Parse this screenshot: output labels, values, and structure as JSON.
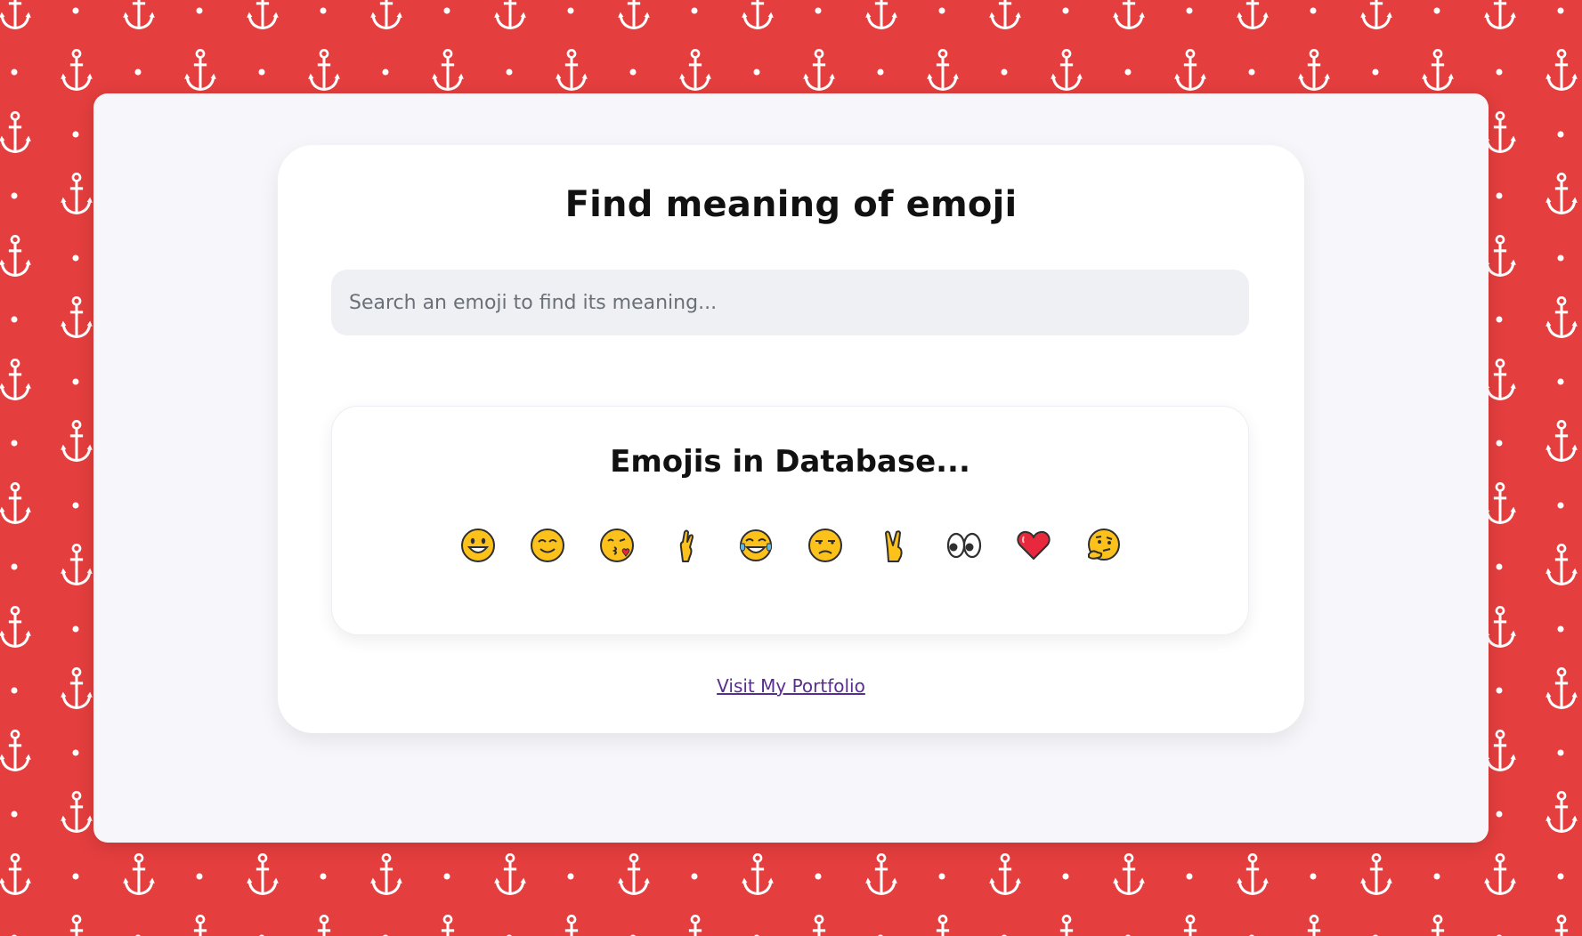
{
  "theme": {
    "background": "#e53e3e",
    "panel": "#f7f7fb",
    "card": "#ffffff",
    "input_bg": "#eef0f4",
    "link": "#5a2e91",
    "pattern_icon": "anchor-icon"
  },
  "header": {
    "title": "Find meaning of emoji"
  },
  "search": {
    "placeholder": "Search an emoji to find its meaning...",
    "value": ""
  },
  "database": {
    "title": "Emojis in Database...",
    "emojis": [
      {
        "char": "😀",
        "icon": "grinning-face-emoji"
      },
      {
        "char": "😊",
        "icon": "smiling-face-emoji"
      },
      {
        "char": "😘",
        "icon": "kissing-face-emoji"
      },
      {
        "char": "🤞",
        "icon": "crossed-fingers-emoji"
      },
      {
        "char": "😂",
        "icon": "tears-of-joy-emoji"
      },
      {
        "char": "😒",
        "icon": "unamused-face-emoji"
      },
      {
        "char": "✌",
        "icon": "victory-hand-emoji"
      },
      {
        "char": "👀",
        "icon": "eyes-emoji"
      },
      {
        "char": "❤",
        "icon": "red-heart-emoji"
      },
      {
        "char": "🤔",
        "icon": "thinking-face-emoji"
      }
    ]
  },
  "footer": {
    "link_label": "Visit My Portfolio"
  }
}
